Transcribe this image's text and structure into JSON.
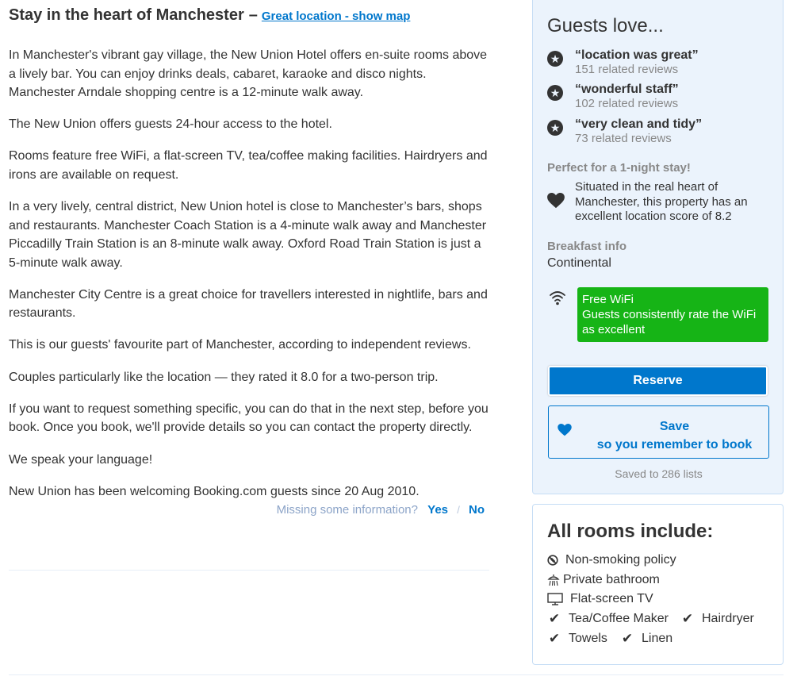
{
  "header": {
    "title": "Stay in the heart of Manchester",
    "dash": "–",
    "map_link": "Great location - show map"
  },
  "description": {
    "paragraphs": [
      "In Manchester's vibrant gay village, the New Union Hotel offers en-suite rooms above a lively bar. You can enjoy drinks deals, cabaret, karaoke and disco nights. Manchester Arndale shopping centre is a 12-minute walk away.",
      "The New Union offers guests 24-hour access to the hotel.",
      "Rooms feature free WiFi, a flat-screen TV, tea/coffee making facilities. Hairdryers and irons are available on request.",
      "In a very lively, central district, New Union hotel is close to Manchester’s bars, shops and restaurants. Manchester Coach Station is a 4-minute walk away and Manchester Piccadilly Train Station is an 8-minute walk away. Oxford Road Train Station is just a 5-minute walk away.",
      "Manchester City Centre is a great choice for travellers interested in nightlife, bars and restaurants.",
      "This is our guests' favourite part of Manchester, according to independent reviews.",
      "Couples particularly like the location — they rated it 8.0 for a two-person trip.",
      "If you want to request something specific, you can do that in the next step, before you book. Once you book, we'll provide details so you can contact the property directly.",
      "We speak your language!",
      "New Union has been welcoming Booking.com guests since 20 Aug 2010."
    ]
  },
  "feedback": {
    "question": "Missing some information?",
    "yes": "Yes",
    "separator": "/",
    "no": "No"
  },
  "sidebar": {
    "guests_love_title": "Guests love...",
    "guests_love": [
      {
        "quote": "“location was great”",
        "count": "151 related reviews",
        "icon": "star-circle-icon"
      },
      {
        "quote": "“wonderful staff”",
        "count": "102 related reviews",
        "icon": "star-circle-icon"
      },
      {
        "quote": "“very clean and tidy”",
        "count": "73 related reviews",
        "icon": "star-circle-icon"
      }
    ],
    "one_night_title": "Perfect for a 1-night stay!",
    "one_night_text": "Situated in the real heart of Manchester, this property has an excellent location score of 8.2",
    "breakfast_title": "Breakfast info",
    "breakfast_value": "Continental",
    "wifi_title": "Free WiFi",
    "wifi_text": "Guests consistently rate the WiFi as excellent",
    "reserve_label": "Reserve",
    "save_label_1": "Save",
    "save_label_2": "so you remember to book",
    "saved_to": "Saved to 286 lists",
    "colors": {
      "accent": "#0077cc",
      "panel_bg": "#ebf3fc",
      "wifi_green": "#16b416"
    }
  },
  "rooms": {
    "title": "All rooms include:",
    "facilities": [
      {
        "label": "Non-smoking policy",
        "icon": "no-smoking-icon"
      },
      {
        "label": "Private bathroom",
        "icon": "shower-icon"
      },
      {
        "label": "Flat-screen TV",
        "icon": "tv-icon"
      },
      {
        "label": "Tea/Coffee Maker",
        "icon": "check-icon"
      },
      {
        "label": "Hairdryer",
        "icon": "check-icon"
      },
      {
        "label": "Towels",
        "icon": "check-icon"
      },
      {
        "label": "Linen",
        "icon": "check-icon"
      }
    ]
  }
}
